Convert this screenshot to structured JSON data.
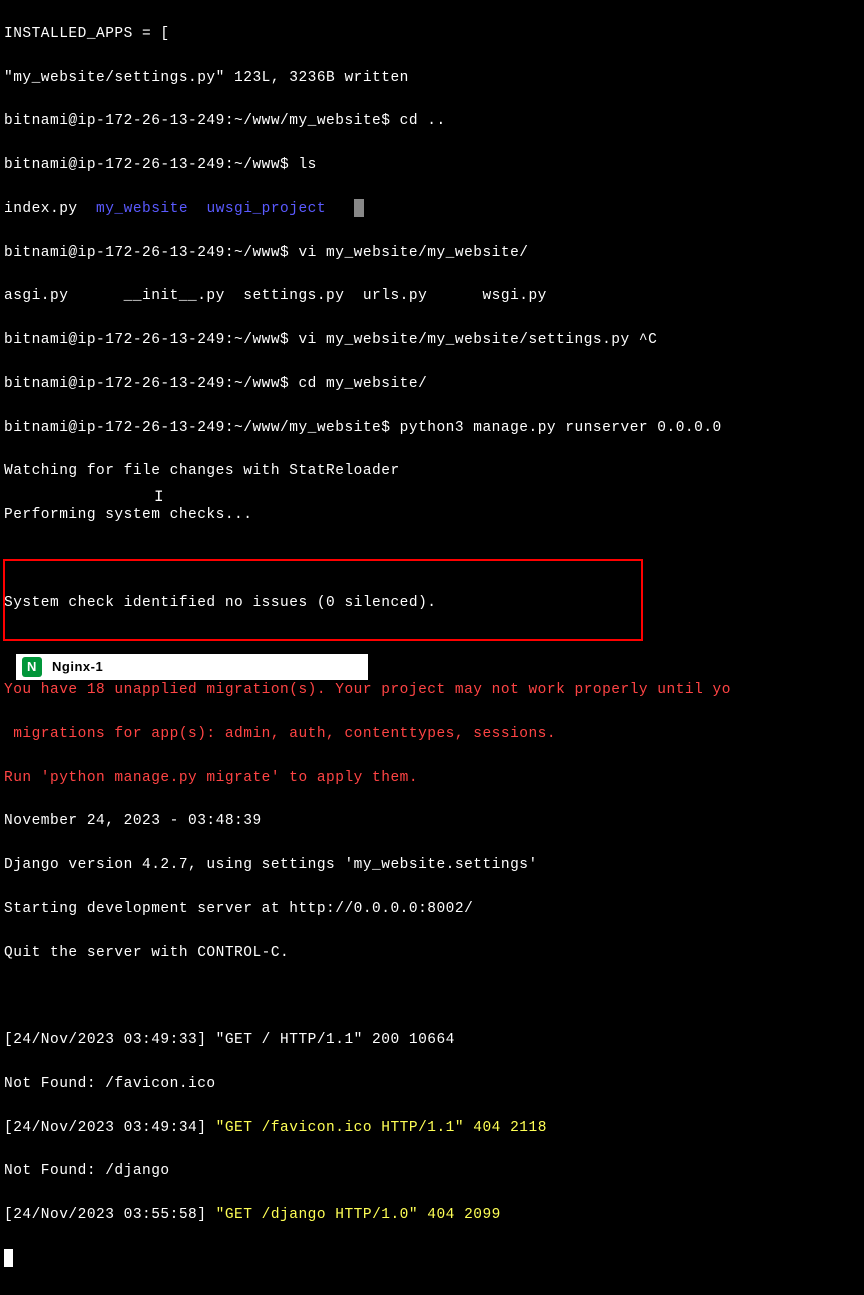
{
  "lines": {
    "l1": "INSTALLED_APPS = [",
    "l2": "\"my_website/settings.py\" 123L, 3236B written",
    "l3a": "bitnami@ip-172-26-13-249:~/www/my_website$ ",
    "l3b": "cd ..",
    "l4a": "bitnami@ip-172-26-13-249:~/www$ ",
    "l4b": "ls",
    "l5a": "index.py  ",
    "l5b": "my_website",
    "l5c": "  ",
    "l5d": "uwsgi_project",
    "l6a": "bitnami@ip-172-26-13-249:~/www$ ",
    "l6b": "vi my_website/my_website/",
    "l7": "asgi.py      __init__.py  settings.py  urls.py      wsgi.py",
    "l8a": "bitnami@ip-172-26-13-249:~/www$ ",
    "l8b": "vi my_website/my_website/settings.py ^C",
    "l9a": "bitnami@ip-172-26-13-249:~/www$ ",
    "l9b": "cd my_website/",
    "l10a": "bitnami@ip-172-26-13-249:~/www/my_website$ ",
    "l10b": "python3 manage.py runserver 0.0.0.0",
    "l11": "Watching for file changes with StatReloader",
    "l12": "Performing system checks...",
    "l13": "",
    "l14": "System check identified no issues (0 silenced).",
    "l15": "",
    "l16": "You have 18 unapplied migration(s). Your project may not work properly until yo",
    "l17": " migrations for app(s): admin, auth, contenttypes, sessions.",
    "l18": "Run 'python manage.py migrate' to apply them.",
    "l19": "November 24, 2023 - 03:48:39",
    "l20": "Django version 4.2.7, using settings 'my_website.settings'",
    "l21": "Starting development server at http://0.0.0.0:8002/",
    "l22": "Quit the server with CONTROL-C.",
    "l23": "",
    "l24": "[24/Nov/2023 03:49:33] \"GET / HTTP/1.1\" 200 10664",
    "l25": "Not Found: /favicon.ico",
    "l26a": "[24/Nov/2023 03:49:34] ",
    "l26b": "\"GET /favicon.ico HTTP/1.1\" 404 2118",
    "l27": "Not Found: /django",
    "l28a": "[24/Nov/2023 03:55:58] ",
    "l28b": "\"GET /django HTTP/1.0\" 404 2099"
  },
  "taskbar": {
    "label": "Nginx-1"
  }
}
